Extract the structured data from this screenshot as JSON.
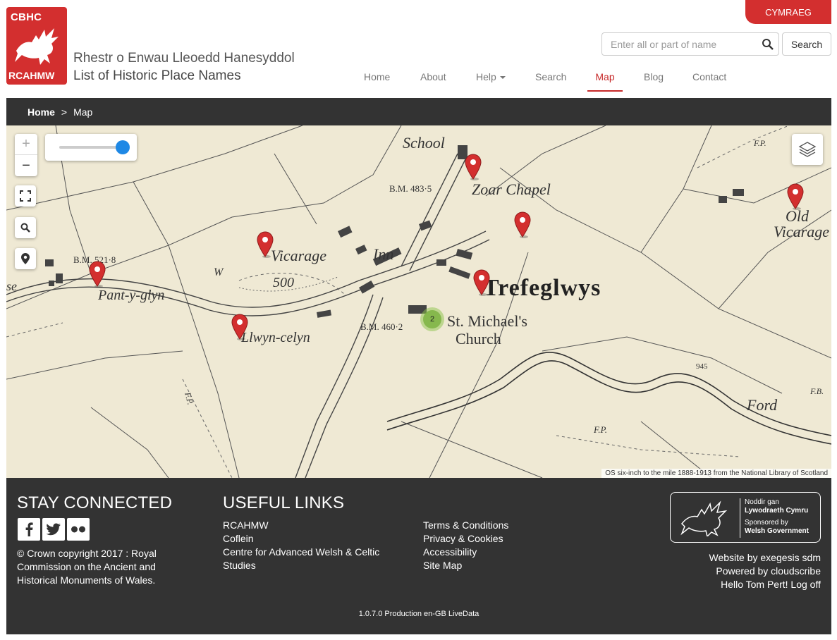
{
  "header": {
    "language_toggle": "CYMRAEG",
    "logo": {
      "line1": "CBHC",
      "line2": "RCAHMW"
    },
    "title_welsh": "Rhestr o Enwau Lleoedd Hanesyddol",
    "title_english": "List of Historic Place Names",
    "search": {
      "placeholder": "Enter all or part of name",
      "value": "",
      "button_label": "Search"
    },
    "nav": [
      {
        "label": "Home",
        "active": false
      },
      {
        "label": "About",
        "active": false
      },
      {
        "label": "Help",
        "active": false,
        "dropdown": true
      },
      {
        "label": "Search",
        "active": false
      },
      {
        "label": "Map",
        "active": true
      },
      {
        "label": "Blog",
        "active": false
      },
      {
        "label": "Contact",
        "active": false
      }
    ],
    "accent_color": "#d32f2f"
  },
  "breadcrumb": {
    "home": "Home",
    "separator": ">",
    "current": "Map"
  },
  "map": {
    "controls": {
      "zoom_in": "+",
      "zoom_out": "−",
      "opacity_level": 1.0,
      "icons": [
        "fullscreen-icon",
        "search-icon",
        "location-pin-icon",
        "layers-icon"
      ]
    },
    "labels": {
      "school": "School",
      "bm_483": "B.M. 483·5",
      "zoar_chapel": "Zoar Chapel",
      "old": "Old",
      "vicarage_old": "Vicarage",
      "bm_521": "B.M. 521·8",
      "vicarage": "Vicarage",
      "inn": "Inn",
      "pant_y_glyn": "Pant-y-glyn",
      "contour_500": "500",
      "w": "W",
      "trefeglwys": "Trefeglwys",
      "st_michaels": "St. Michael's",
      "church": "Church",
      "bm_460": "B.M. 460·2",
      "llwyn_celyn": "Llwyn-celyn",
      "ford": "Ford",
      "fp1": "F.P.",
      "fp2": "F.P.",
      "fp3": "F.P.",
      "fb": "F.B.",
      "se": "se",
      "n945": "945"
    },
    "cluster_count": "2",
    "attribution": "OS six-inch to the mile 1888-1913 from the National Library of Scotland",
    "marker_color": "#d32f2f",
    "cluster_color": "#8bc34a"
  },
  "footer": {
    "stay_connected": "STAY CONNECTED",
    "social": [
      "facebook-icon",
      "twitter-icon",
      "flickr-icon"
    ],
    "copyright": "© Crown copyright 2017 : Royal Commission on the Ancient and Historical Monuments of Wales.",
    "useful_links_title": "USEFUL LINKS",
    "links_col1": [
      "RCAHMW",
      "Coflein",
      "Centre for Advanced Welsh & Celtic Studies"
    ],
    "links_col2": [
      "Terms & Conditions",
      "Privacy & Cookies",
      "Accessibility",
      "Site Map"
    ],
    "gov": {
      "l1": "Noddir gan",
      "l2": "Lywodraeth Cymru",
      "l3": "Sponsored by",
      "l4": "Welsh Government"
    },
    "credits": [
      "Website by exegesis sdm",
      "Powered by cloudscribe",
      "Hello Tom Pert! Log off"
    ],
    "version": "1.0.7.0 Production en-GB LiveData"
  }
}
